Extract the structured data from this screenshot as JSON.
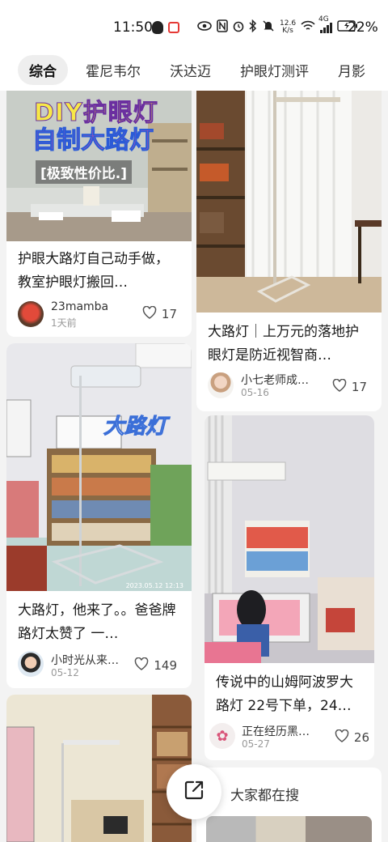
{
  "status_bar": {
    "time": "11:50",
    "net_speed_top": "12.6",
    "net_speed_unit": "K/s",
    "signal_label": "4G",
    "battery": "22%"
  },
  "tabs": [
    {
      "label": "综合",
      "active": true
    },
    {
      "label": "霍尼韦尔",
      "active": false
    },
    {
      "label": "沃达迈",
      "active": false
    },
    {
      "label": "护眼灯测评",
      "active": false
    },
    {
      "label": "月影",
      "active": false
    }
  ],
  "cards": [
    {
      "title": "护眼大路灯自己动手做，教室护眼灯搬回…",
      "overlay": [
        "DIY护眼灯",
        "自制大路灯",
        "[极致性价比.]"
      ],
      "author": "23mamba",
      "date": "1天前",
      "likes": "17"
    },
    {
      "title": "大路灯｜上万元的落地护眼灯是防近视智商…",
      "author": "小七老师成…",
      "date": "05-16",
      "likes": "17"
    },
    {
      "title": "大路灯，他来了。。爸爸牌路灯太赞了 一…",
      "overlay": [
        "大路灯"
      ],
      "photo_stamp": "2023.05.12  12:13",
      "author": "小时光从来…",
      "date": "05-12",
      "likes": "149"
    },
    {
      "title": "传说中的山姆阿波罗大路灯 22号下单，24…",
      "author": "正在经历黑…",
      "date": "05-27",
      "likes": "26"
    }
  ],
  "search_suggest": {
    "label": "大家都在搜"
  },
  "colors": {
    "accent": "#e53935",
    "card_bg": "#ffffff",
    "page_bg": "#f3f3f3"
  }
}
